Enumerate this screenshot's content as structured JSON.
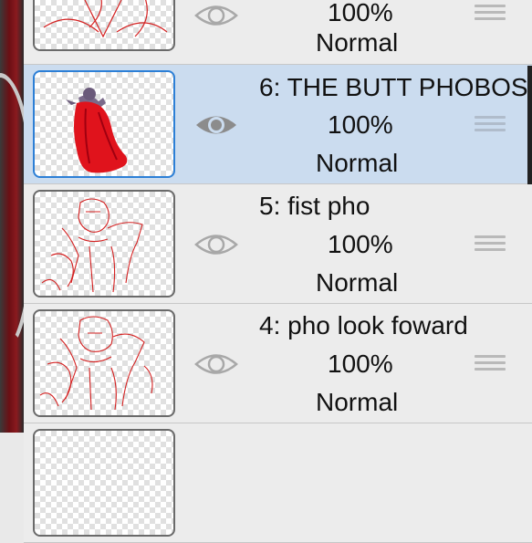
{
  "layers": [
    {
      "id": "row-7",
      "name": "",
      "opacity": "100%",
      "blend": "Normal",
      "selected": false,
      "visible": true,
      "thumbnail": "red-sketch-icon"
    },
    {
      "id": "row-6",
      "name": "6: THE BUTT PHOBOS",
      "opacity": "100%",
      "blend": "Normal",
      "selected": true,
      "visible": true,
      "thumbnail": "red-cape-figure-icon"
    },
    {
      "id": "row-5",
      "name": "5: fist pho",
      "opacity": "100%",
      "blend": "Normal",
      "selected": false,
      "visible": true,
      "thumbnail": "red-sketch-icon"
    },
    {
      "id": "row-4",
      "name": "4: pho look foward",
      "opacity": "100%",
      "blend": "Normal",
      "selected": false,
      "visible": true,
      "thumbnail": "red-sketch-icon"
    }
  ],
  "colors": {
    "selected_row": "#cbdcef",
    "row": "#ececec",
    "selected_border": "#2c7fd6",
    "eye_selected": "#8c8c8c",
    "eye": "#a8a8a8",
    "sketch": "#d42020"
  }
}
